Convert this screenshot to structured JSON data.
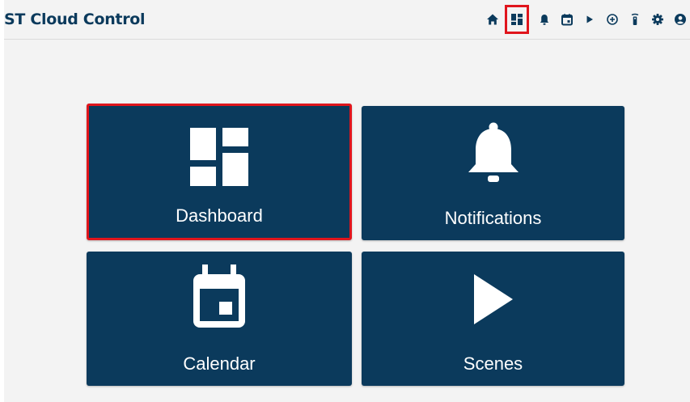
{
  "app": {
    "title": "ST Cloud Control",
    "colors": {
      "primary": "#0b3a5c",
      "highlight": "#e0151c",
      "background": "#f3f3f3"
    }
  },
  "nav": [
    {
      "icon": "home-icon",
      "selected": false
    },
    {
      "icon": "dashboard-icon",
      "selected": true
    },
    {
      "icon": "bell-icon",
      "selected": false
    },
    {
      "icon": "calendar-icon",
      "selected": false
    },
    {
      "icon": "play-icon",
      "selected": false
    },
    {
      "icon": "add-circle-icon",
      "selected": false
    },
    {
      "icon": "remote-icon",
      "selected": false
    },
    {
      "icon": "gear-icon",
      "selected": false
    },
    {
      "icon": "account-icon",
      "selected": false
    }
  ],
  "tiles": [
    {
      "label": "Dashboard",
      "icon": "dashboard-icon",
      "selected": true
    },
    {
      "label": "Notifications",
      "icon": "bell-icon",
      "selected": false
    },
    {
      "label": "Calendar",
      "icon": "calendar-icon",
      "selected": false
    },
    {
      "label": "Scenes",
      "icon": "play-icon",
      "selected": false
    }
  ]
}
